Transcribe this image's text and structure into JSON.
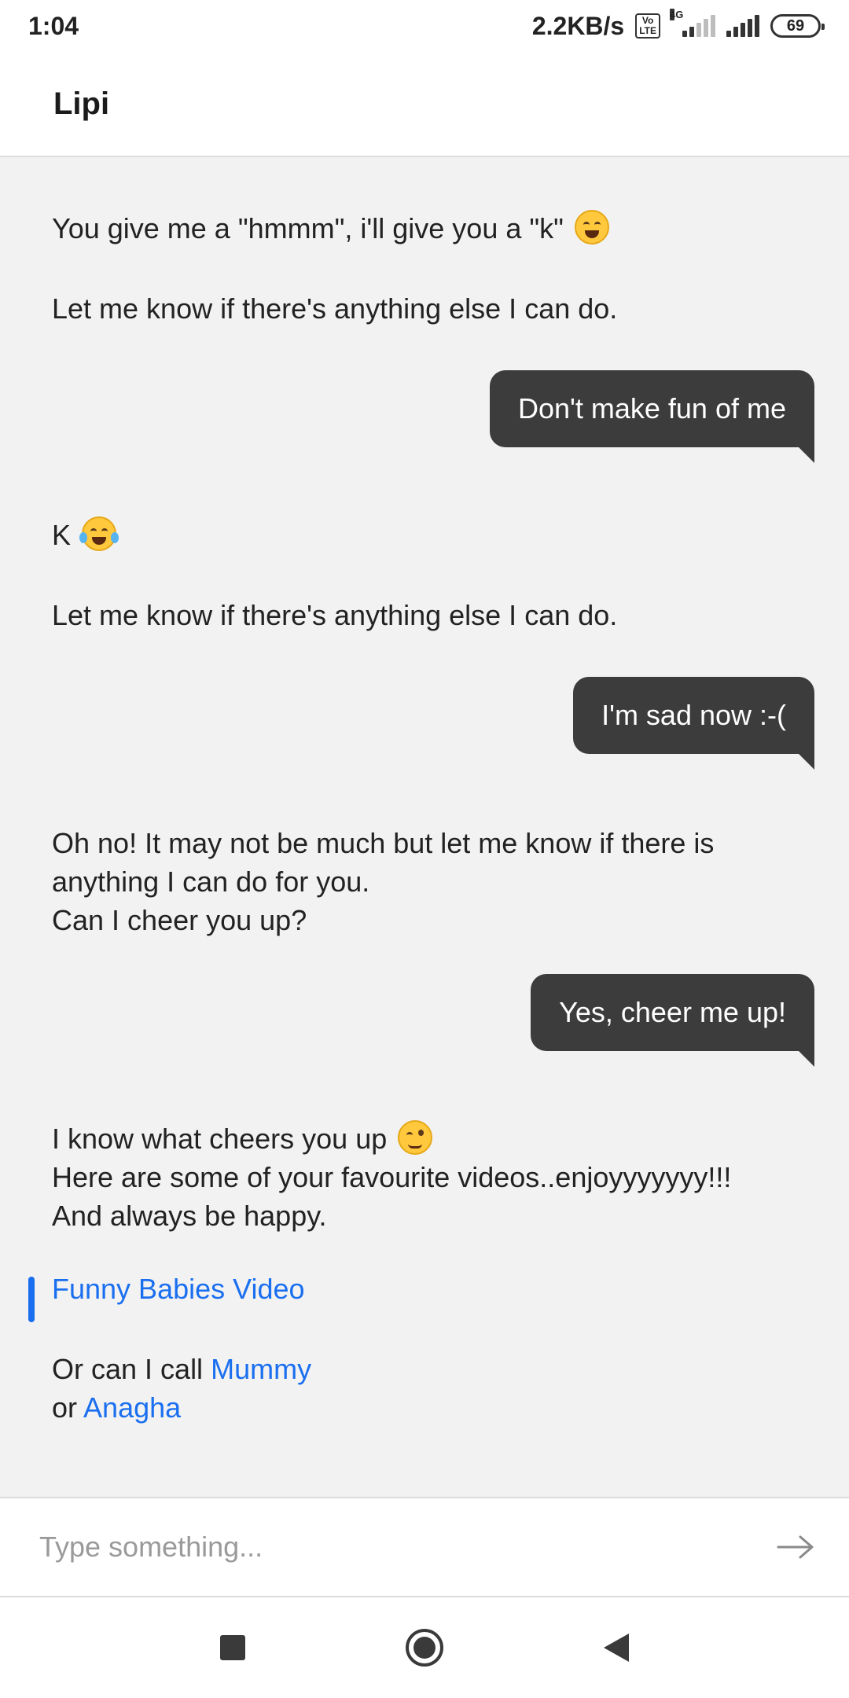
{
  "status_bar": {
    "time": "1:04",
    "speed": "2.2KB/s",
    "volte": "Vo\nLTE",
    "network": "4G",
    "battery": "69"
  },
  "app_bar": {
    "title": "Lipi"
  },
  "messages": {
    "bot1": {
      "line1": "You give me a \"hmmm\", i'll give you a \"k\"",
      "emoji": "grinning-squinting-face-icon",
      "line2": "Let me know if there's anything else I can do."
    },
    "user1": "Don't make fun of me",
    "bot2": {
      "line1": "K",
      "emoji": "face-with-tears-of-joy-icon",
      "line2": "Let me know if there's anything else I can do."
    },
    "user2": "I'm sad now :-(",
    "bot3": {
      "line1": "Oh no! It may not be much but let me know if there is",
      "line2": "anything I can do for you.",
      "line3": "Can I cheer you up?"
    },
    "user3": "Yes, cheer me up!",
    "bot4": {
      "line1": "I know what cheers you up",
      "emoji": "winking-face-icon",
      "line2": "Here are some of your favourite videos..enjoyyyyyyy!!!",
      "line3": "And always be happy.",
      "video_link": "Funny Babies Video",
      "call_prefix": "Or can I call",
      "call_link_1": "Mummy",
      "or_word": "or",
      "call_link_2": "Anagha"
    }
  },
  "input": {
    "placeholder": "Type something..."
  },
  "colors": {
    "link": "#1a6ff0",
    "user_bubble": "#3c3c3c",
    "background": "#f2f2f2"
  }
}
